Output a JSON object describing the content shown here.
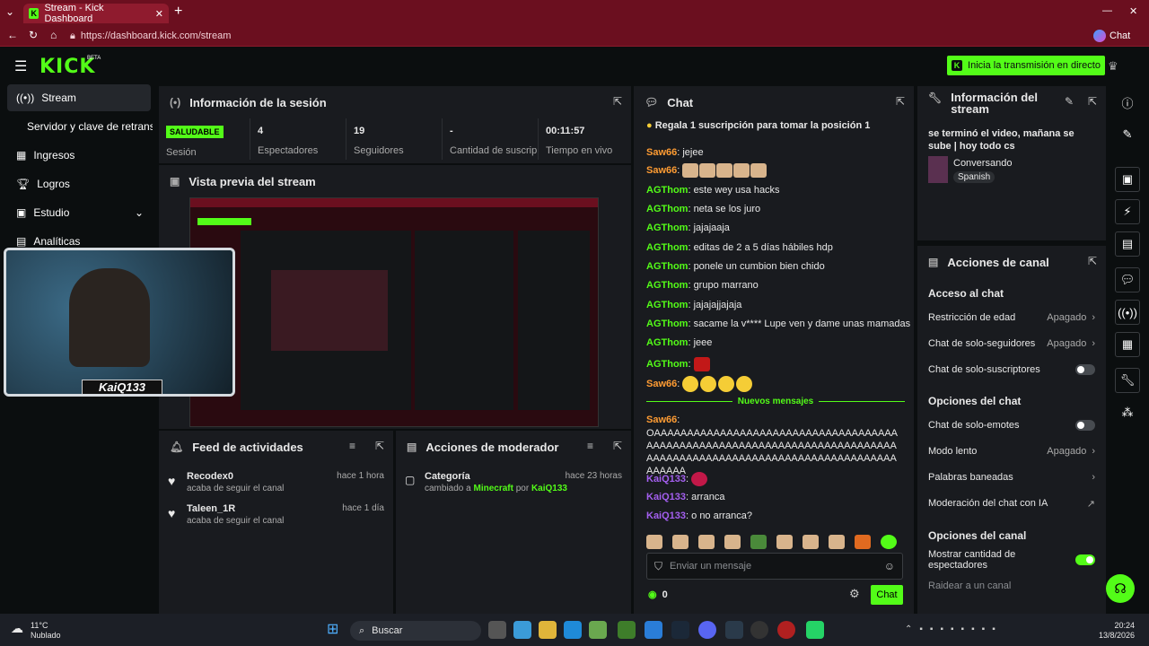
{
  "browser": {
    "tab_title": "Stream - Kick Dashboard",
    "url": "https://dashboard.kick.com/stream",
    "chat_label": "Chat"
  },
  "header": {
    "logo": "KICK",
    "beta": "BETA",
    "go_live": "Inicia la transmisión en directo"
  },
  "sidebar": {
    "items": [
      {
        "label": "Stream",
        "icon": "broadcast-icon",
        "active": true
      },
      {
        "label": "Servidor y clave de retransm",
        "icon": "",
        "active": false
      },
      {
        "label": "Ingresos",
        "icon": "chart-icon",
        "active": false
      },
      {
        "label": "Logros",
        "icon": "trophy-icon",
        "active": false
      },
      {
        "label": "Estudio",
        "icon": "studio-icon",
        "active": false
      },
      {
        "label": "Analíticas",
        "icon": "analytics-icon",
        "active": false
      }
    ]
  },
  "session": {
    "title": "Información de la sesión",
    "stats": [
      {
        "value": "SALUDABLE",
        "label": "Sesión"
      },
      {
        "value": "4",
        "label": "Espectadores"
      },
      {
        "value": "19",
        "label": "Seguidores"
      },
      {
        "value": "-",
        "label": "Cantidad de suscripciones"
      },
      {
        "value": "00:11:57",
        "label": "Tiempo en vivo"
      }
    ]
  },
  "preview": {
    "title": "Vista previa del stream"
  },
  "webcam": {
    "name": "KaiQ133"
  },
  "activity": {
    "title": "Feed de actividades",
    "items": [
      {
        "user": "Recodex0",
        "action": "acaba de seguir el canal",
        "time": "hace 1 hora"
      },
      {
        "user": "Taleen_1R",
        "action": "acaba de seguir el canal",
        "time": "hace 1 día"
      }
    ]
  },
  "modactions": {
    "title": "Acciones de moderador",
    "items": [
      {
        "title": "Categoría",
        "prefix": "cambiado a",
        "category": "Minecraft",
        "by": "por",
        "user": "KaiQ133",
        "time": "hace 23 horas"
      }
    ]
  },
  "chat": {
    "title": "Chat",
    "pinned": "Regala 1 suscripción para tomar la posición 1",
    "new_messages": "Nuevos mensajes",
    "messages": [
      {
        "user": "Saw66",
        "text": ": jejee"
      },
      {
        "user": "Saw66",
        "text": ":"
      },
      {
        "user": "AGThom",
        "text": ": este wey usa hacks"
      },
      {
        "user": "AGThom",
        "text": ": neta se los juro"
      },
      {
        "user": "AGThom",
        "text": ": jajajaaja"
      },
      {
        "user": "AGThom",
        "text": ": editas de 2 a 5 días hábiles hdp"
      },
      {
        "user": "AGThom",
        "text": ": ponele un cumbion bien chido"
      },
      {
        "user": "AGThom",
        "text": ": grupo marrano"
      },
      {
        "user": "AGThom",
        "text": ": jajajajjajaja"
      },
      {
        "user": "AGThom",
        "text": ": sacame la v**** Lupe ven y dame unas mamadas"
      },
      {
        "user": "AGThom",
        "text": ": jeee"
      },
      {
        "user": "AGThom",
        "text": ":"
      },
      {
        "user": "Saw66",
        "text": ":"
      }
    ],
    "after": [
      {
        "user": "Saw66",
        "text": ":"
      },
      {
        "user": "KaiQ133",
        "text": ":"
      },
      {
        "user": "KaiQ133",
        "text": ": arranca"
      },
      {
        "user": "KaiQ133",
        "text": ": o no arranca?"
      }
    ],
    "long_text": "OAAAAAAAAAAAAAAAAAAAAAAAAAAAAAAAAAAAAAAAAAAAAAAAAAAAAAAAAAAAAAAAAAAAAAAAAAAAAAAAAAAAAAAAAAAAAAAAAAAAAAAAAAAAAAAAAAAAAAAA",
    "input_placeholder": "Enviar un mensaje",
    "count": "0",
    "send": "Chat"
  },
  "streaminfo": {
    "title": "Información del stream",
    "stream_title": "se terminó el video, mañana se sube | hoy todo cs",
    "category": "Conversando",
    "language": "Spanish"
  },
  "channel": {
    "title": "Acciones de canal",
    "chat_access": "Acceso al chat",
    "rows1": [
      {
        "label": "Restricción de edad",
        "value": "Apagado",
        "type": "arrow"
      },
      {
        "label": "Chat de solo-seguidores",
        "value": "Apagado",
        "type": "arrow"
      },
      {
        "label": "Chat de solo-suscriptores",
        "value": "",
        "type": "toggle-off"
      }
    ],
    "chat_options": "Opciones del chat",
    "rows2": [
      {
        "label": "Chat de solo-emotes",
        "value": "",
        "type": "toggle-off"
      },
      {
        "label": "Modo lento",
        "value": "Apagado",
        "type": "arrow"
      },
      {
        "label": "Palabras baneadas",
        "value": "",
        "type": "arrow"
      },
      {
        "label": "Moderación del chat con IA",
        "value": "",
        "type": "external"
      }
    ],
    "channel_options": "Opciones del canal",
    "rows3": [
      {
        "label": "Mostrar cantidad de espectadores",
        "value": "",
        "type": "toggle-on"
      }
    ],
    "raid": "Raidear a un canal"
  },
  "taskbar": {
    "temp": "11°C",
    "weather": "Nublado",
    "search": "Buscar",
    "time": "20:24",
    "date": "13/8/2026"
  },
  "colors": {
    "brand": "#53fc18",
    "panel": "#191b1f",
    "bg": "#0b0e0f",
    "browser": "#6b0f1f"
  }
}
